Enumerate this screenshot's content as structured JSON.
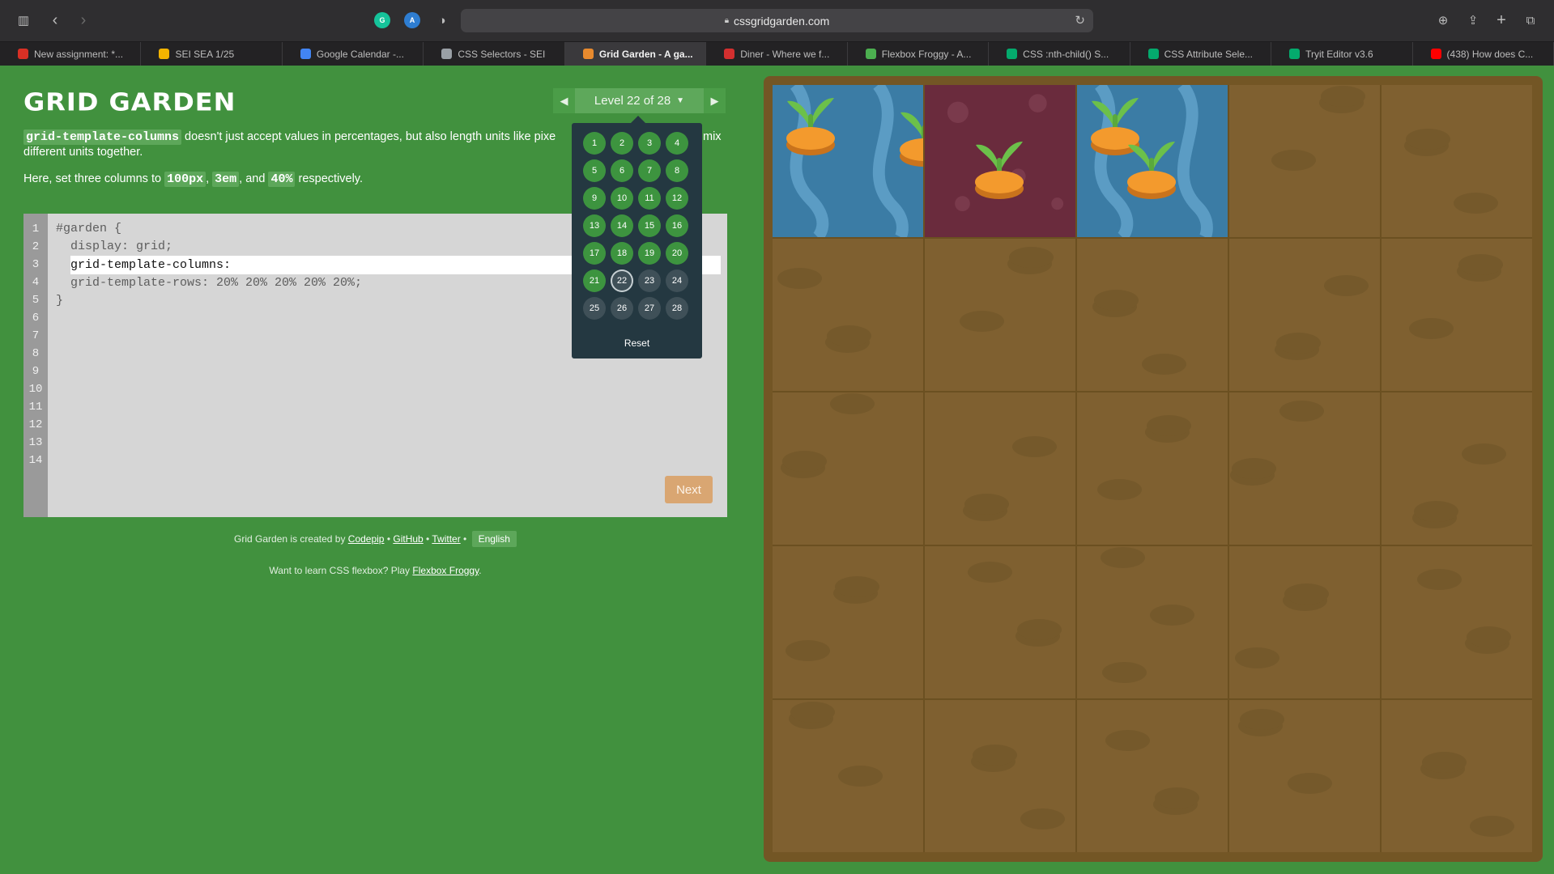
{
  "browser": {
    "url": "cssgridgarden.com",
    "tabs": [
      {
        "label": "New assignment: *...",
        "icon": "gmail-icon",
        "color": "#d93025"
      },
      {
        "label": "SEI SEA 1/25",
        "icon": "classroom-icon",
        "color": "#f4b400"
      },
      {
        "label": "Google Calendar -...",
        "icon": "google-icon",
        "color": "#4285f4"
      },
      {
        "label": "CSS Selectors - SEI",
        "icon": "g-icon",
        "color": "#9aa0a6"
      },
      {
        "label": "Grid Garden - A ga...",
        "icon": "carrot-icon",
        "color": "#e88a2e",
        "active": true
      },
      {
        "label": "Diner - Where we f...",
        "icon": "diner-icon",
        "color": "#d32f2f"
      },
      {
        "label": "Flexbox Froggy - A...",
        "icon": "frog-icon",
        "color": "#4caf50"
      },
      {
        "label": "CSS :nth-child() S...",
        "icon": "w-icon",
        "color": "#04aa6d"
      },
      {
        "label": "CSS Attribute Sele...",
        "icon": "w-icon",
        "color": "#04aa6d"
      },
      {
        "label": "Tryit Editor v3.6",
        "icon": "w-icon",
        "color": "#04aa6d"
      },
      {
        "label": "(438) How does C...",
        "icon": "youtube-icon",
        "color": "#ff0000"
      }
    ]
  },
  "game": {
    "title": "GRID GARDEN",
    "level_label": "Level 22 of 28",
    "instructions": {
      "p1_code": "grid-template-columns",
      "p1_text": " doesn't just accept values in percentages, but also length units like pixe",
      "p1_tail": "mix",
      "p1_line2": "different units together.",
      "p2_pre": "Here, set three columns to ",
      "p2_v1": "100px",
      "p2_sep1": ", ",
      "p2_v2": "3em",
      "p2_sep2": ", and ",
      "p2_v3": "40%",
      "p2_post": " respectively."
    },
    "editor": {
      "line_numbers": [
        "1",
        "2",
        "3",
        "4",
        "5",
        "6",
        "7",
        "8",
        "9",
        "10",
        "11",
        "12",
        "13",
        "14"
      ],
      "line1": "#garden {",
      "line2": "  display: grid;",
      "input_value": "grid-template-columns: ",
      "line4": "  grid-template-rows: 20% 20% 20% 20% 20%;",
      "line5": "}"
    },
    "next_label": "Next",
    "credits": {
      "prefix": "Grid Garden is created by ",
      "codepip": "Codepip",
      "sep": " • ",
      "github": "GitHub",
      "twitter": "Twitter",
      "language": "English"
    },
    "promo": {
      "text": "Want to learn CSS flexbox? Play ",
      "link": "Flexbox Froggy",
      "end": "."
    },
    "level_menu": {
      "levels": [
        {
          "n": "1",
          "s": "done"
        },
        {
          "n": "2",
          "s": "done"
        },
        {
          "n": "3",
          "s": "done"
        },
        {
          "n": "4",
          "s": "done"
        },
        {
          "n": "5",
          "s": "done"
        },
        {
          "n": "6",
          "s": "done"
        },
        {
          "n": "7",
          "s": "done"
        },
        {
          "n": "8",
          "s": "done"
        },
        {
          "n": "9",
          "s": "done"
        },
        {
          "n": "10",
          "s": "done"
        },
        {
          "n": "11",
          "s": "done"
        },
        {
          "n": "12",
          "s": "done"
        },
        {
          "n": "13",
          "s": "done"
        },
        {
          "n": "14",
          "s": "done"
        },
        {
          "n": "15",
          "s": "done"
        },
        {
          "n": "16",
          "s": "done"
        },
        {
          "n": "17",
          "s": "done"
        },
        {
          "n": "18",
          "s": "done"
        },
        {
          "n": "19",
          "s": "done"
        },
        {
          "n": "20",
          "s": "done"
        },
        {
          "n": "21",
          "s": "done"
        },
        {
          "n": "22",
          "s": "current"
        },
        {
          "n": "23",
          "s": "todo"
        },
        {
          "n": "24",
          "s": "todo"
        },
        {
          "n": "25",
          "s": "todo"
        },
        {
          "n": "26",
          "s": "todo"
        },
        {
          "n": "27",
          "s": "todo"
        },
        {
          "n": "28",
          "s": "todo"
        }
      ],
      "reset_label": "Reset"
    },
    "garden": {
      "cells": [
        "water",
        "poison",
        "water",
        "soil",
        "soil",
        "soil",
        "soil",
        "soil",
        "soil",
        "soil",
        "soil",
        "soil",
        "soil",
        "soil",
        "soil",
        "soil",
        "soil",
        "soil",
        "soil",
        "soil",
        "soil",
        "soil",
        "soil",
        "soil",
        "soil"
      ],
      "colors": {
        "water": "#3b7ca5",
        "poison": "#6a2b3d",
        "soil": "#7f6030",
        "carrot": "#f39a2d",
        "leaf": "#6cc04a"
      }
    }
  }
}
